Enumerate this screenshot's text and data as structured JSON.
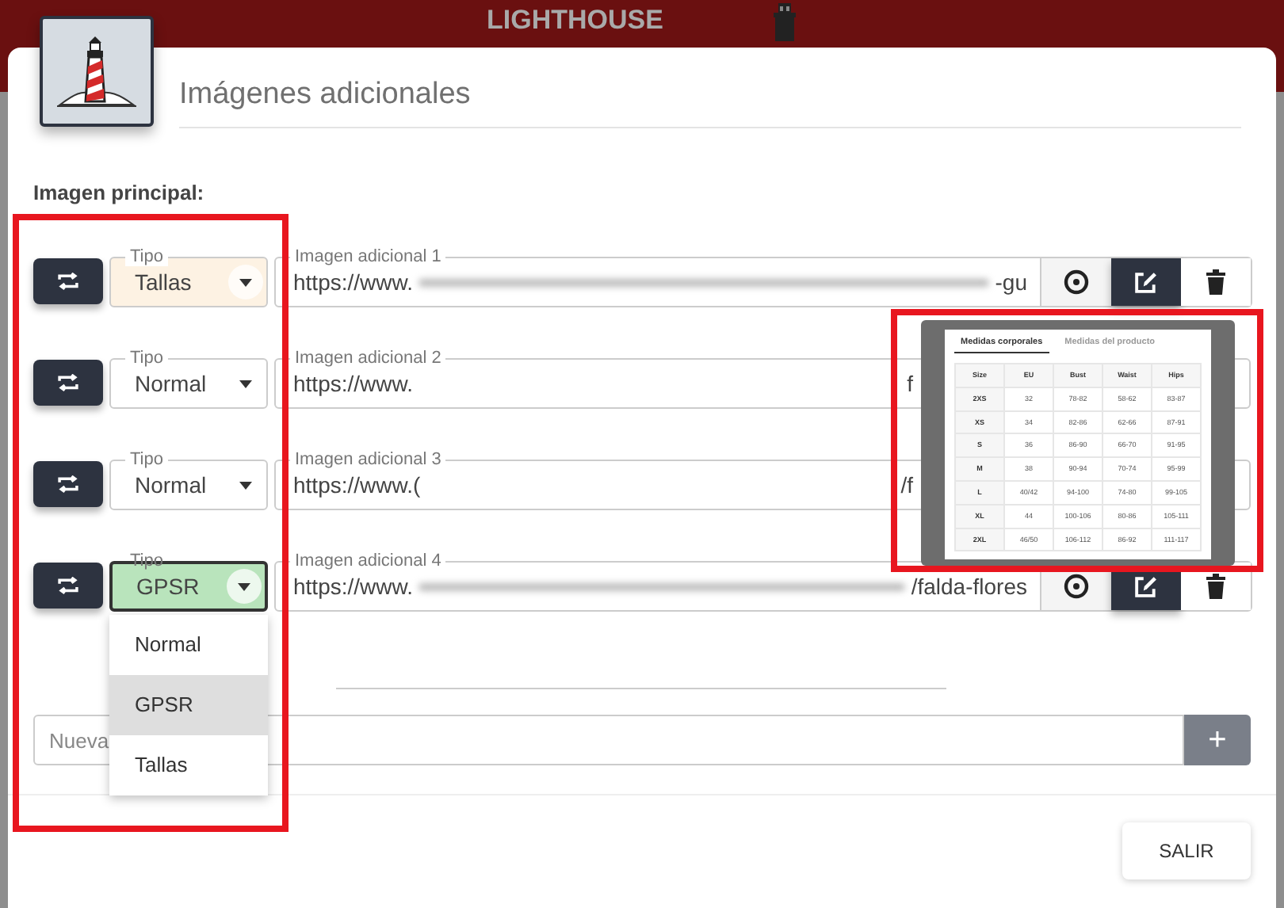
{
  "header": {
    "brand": "LIGHTHOUSE"
  },
  "dialog": {
    "title": "Imágenes adicionales",
    "section_label": "Imagen principal:",
    "rows": [
      {
        "type_label": "Tipo",
        "type": "Tallas",
        "color": "#fdf2e3",
        "open": false,
        "url_label": "Imagen adicional 1",
        "url_start": "https://www.",
        "redacted": true,
        "url_end": "-gu",
        "actions": [
          {
            "kind": "view"
          },
          {
            "kind": "edit"
          },
          {
            "kind": "delete"
          }
        ]
      },
      {
        "type_label": "Tipo",
        "type": "Normal",
        "open": false,
        "url_label": "Imagen adicional 2",
        "url_start": "https://www.",
        "redacted": false,
        "url_end": "f",
        "actions": []
      },
      {
        "type_label": "Tipo",
        "type": "Normal",
        "open": false,
        "url_label": "Imagen adicional 3",
        "url_start": "https://www.(",
        "redacted": false,
        "url_end": "/f",
        "actions": []
      },
      {
        "type_label": "Tipo",
        "type": "GPSR",
        "color": "#b9e4bc",
        "open": true,
        "url_label": "Imagen adicional 4",
        "url_start": "https://www.",
        "redacted": true,
        "url_end": "/falda-flores",
        "actions": [
          {
            "kind": "view"
          },
          {
            "kind": "edit"
          },
          {
            "kind": "delete"
          }
        ]
      }
    ],
    "type_menu": [
      {
        "label": "Normal",
        "selected": false
      },
      {
        "label": "GPSR",
        "selected": true
      },
      {
        "label": "Tallas",
        "selected": false
      }
    ],
    "new_field": {
      "placeholder": "Nueva"
    },
    "add_button": "+",
    "exit_button": "SALIR"
  },
  "preview": {
    "tabs": [
      {
        "label": "Medidas corporales",
        "selected": true
      },
      {
        "label": "Medidas del producto",
        "selected": false
      }
    ],
    "columns": [
      "Size",
      "EU",
      "Bust",
      "Waist",
      "Hips"
    ],
    "rows": [
      [
        "2XS",
        "32",
        "78-82",
        "58-62",
        "83-87"
      ],
      [
        "XS",
        "34",
        "82-86",
        "62-66",
        "87-91"
      ],
      [
        "S",
        "36",
        "86-90",
        "66-70",
        "91-95"
      ],
      [
        "M",
        "38",
        "90-94",
        "70-74",
        "95-99"
      ],
      [
        "L",
        "40/42",
        "94-100",
        "74-80",
        "99-105"
      ],
      [
        "XL",
        "44",
        "100-106",
        "80-86",
        "105-111"
      ],
      [
        "2XL",
        "46/50",
        "106-112",
        "86-92",
        "111-117"
      ]
    ]
  },
  "highlights": {
    "type_column": true,
    "preview": true
  }
}
